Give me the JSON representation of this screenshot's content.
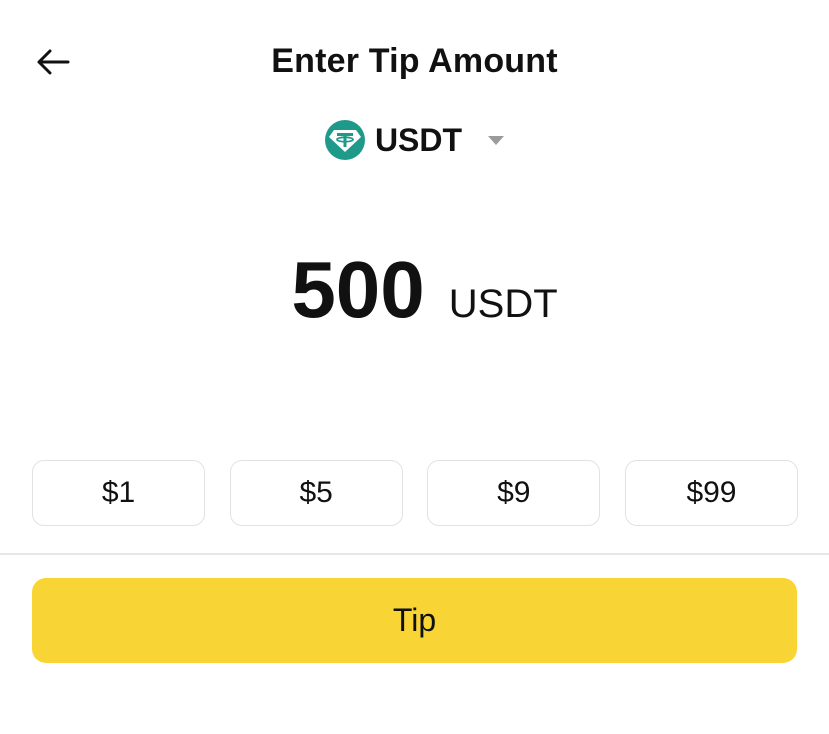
{
  "header": {
    "title": "Enter Tip Amount",
    "back_icon": "arrow-left-icon"
  },
  "currency": {
    "symbol": "USDT",
    "icon": "tether-icon",
    "icon_color": "#1f9a8a"
  },
  "amount": {
    "value": "500",
    "unit": "USDT"
  },
  "presets": [
    {
      "label": "$1"
    },
    {
      "label": "$5"
    },
    {
      "label": "$9"
    },
    {
      "label": "$99"
    }
  ],
  "actions": {
    "tip_label": "Tip",
    "tip_color": "#f9d435"
  }
}
